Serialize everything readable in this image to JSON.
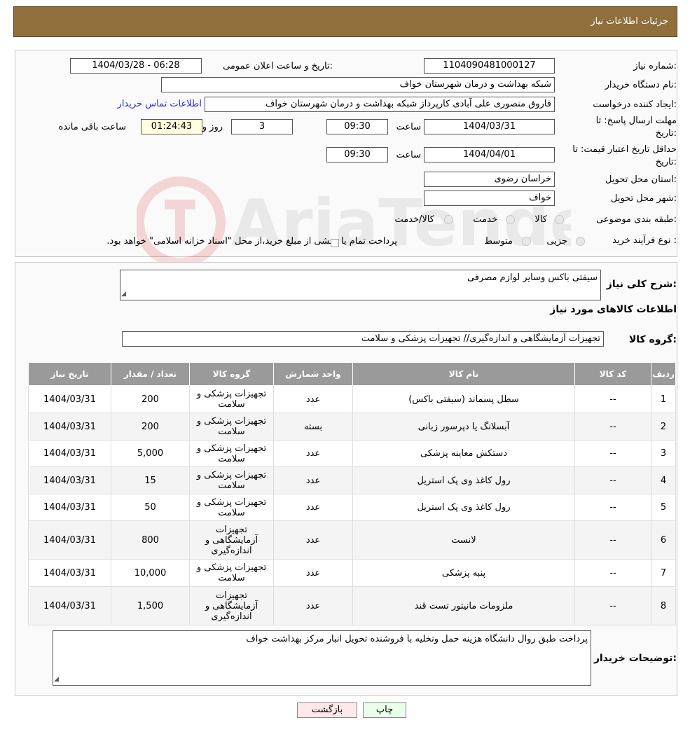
{
  "header": {
    "title": "جزئیات اطلاعات نیاز"
  },
  "watermark": {
    "text": "AriaTender.neT"
  },
  "form": {
    "need_number_label": "شماره نیاز:",
    "need_number": "1104090481000127",
    "announce_label": "تاریخ و ساعت اعلان عمومی:",
    "announce_value": "1404/03/28 - 06:28",
    "buyer_org_label": "نام دستگاه خریدار:",
    "buyer_org": "شبکه بهداشت و درمان شهرستان خواف",
    "requester_label": "ایجاد کننده درخواست:",
    "requester": "فاروق منصوری علی آبادی کارپرداز شبکه بهداشت و درمان شهرستان خواف",
    "contact_link": "اطلاعات تماس خریدار",
    "deadline_label_1": "مهلت ارسال پاسخ: تا",
    "deadline_label_2": "تاریخ:",
    "deadline_date": "1404/03/31",
    "time_label": "ساعت",
    "deadline_time": "09:30",
    "days": "3",
    "days_label": "روز و",
    "remaining": "01:24:43",
    "remaining_label": "ساعت باقی مانده",
    "validity_label_1": "حداقل تاریخ اعتبار قیمت: تا",
    "validity_label_2": "تاریخ:",
    "validity_date": "1404/04/01",
    "validity_time": "09:30",
    "province_label": "استان محل تحویل:",
    "province": "خراسان رضوی",
    "city_label": "شهر محل تحویل:",
    "city": "خواف",
    "category_label": "طبقه بندی موضوعی:",
    "cat_options": [
      "کالا",
      "خدمت",
      "کالا/خدمت"
    ],
    "process_label": "نوع فرآیند خرید :",
    "process_options": [
      "جزیی",
      "متوسط"
    ],
    "process_note": "پرداخت تمام یا بخشی از مبلغ خرید،از محل \"اسناد خزانه اسلامی\" خواهد بود."
  },
  "details": {
    "desc_label": "شرح کلی نیاز:",
    "desc": "سیفتی باکس وسایر لوازم مصرفی",
    "goods_title": "اطلاعات کالاهای مورد نیاز",
    "group_label": "گروه کالا:",
    "group": "تجهیزات آزمایشگاهی و اندازه‌گیری// تجهیزات پزشکی و سلامت",
    "columns": [
      "ردیف",
      "کد کالا",
      "نام کالا",
      "واحد شمارش",
      "گروه کالا",
      "تعداد / مقدار",
      "تاریخ نیاز"
    ],
    "rows": [
      {
        "n": "1",
        "code": "--",
        "name": "سطل پسماند (سیفتی باکس)",
        "unit": "عدد",
        "group": "تجهیزات پزشکی و سلامت",
        "qty": "200",
        "date": "1404/03/31"
      },
      {
        "n": "2",
        "code": "--",
        "name": "آبسلانگ یا دپرسور زبانی",
        "unit": "بسته",
        "group": "تجهیزات پزشکی و سلامت",
        "qty": "200",
        "date": "1404/03/31"
      },
      {
        "n": "3",
        "code": "--",
        "name": "دستکش معاینه پزشکی",
        "unit": "عدد",
        "group": "تجهیزات پزشکی و سلامت",
        "qty": "5,000",
        "date": "1404/03/31"
      },
      {
        "n": "4",
        "code": "--",
        "name": "رول کاغذ وی پک استریل",
        "unit": "عدد",
        "group": "تجهیزات پزشکی و سلامت",
        "qty": "15",
        "date": "1404/03/31"
      },
      {
        "n": "5",
        "code": "--",
        "name": "رول کاغذ وی پک استریل",
        "unit": "عدد",
        "group": "تجهیزات پزشکی و سلامت",
        "qty": "50",
        "date": "1404/03/31"
      },
      {
        "n": "6",
        "code": "--",
        "name": "لانست",
        "unit": "عدد",
        "group": "تجهیزات آزمایشگاهی و اندازه‌گیری",
        "qty": "800",
        "date": "1404/03/31"
      },
      {
        "n": "7",
        "code": "--",
        "name": "پنبه پزشکی",
        "unit": "عدد",
        "group": "تجهیزات پزشکی و سلامت",
        "qty": "10,000",
        "date": "1404/03/31"
      },
      {
        "n": "8",
        "code": "--",
        "name": "ملزومات مانیتور تست قند",
        "unit": "عدد",
        "group": "تجهیزات آزمایشگاهی و اندازه‌گیری",
        "qty": "1,500",
        "date": "1404/03/31"
      }
    ],
    "buyer_notes_label": "توضیحات خریدار:",
    "buyer_notes": "پرداخت طبق روال دانشگاه هزینه حمل وتخلیه با فروشنده تحویل انبار مرکز بهداشت خواف"
  },
  "buttons": {
    "print": "چاپ",
    "back": "بازگشت"
  },
  "colors": {
    "header": "#906f3d",
    "table_header": "#9a9a9a",
    "link": "#2b2bd8",
    "remaining_bg": "#ffffe0",
    "print_bg": "#eaffea",
    "back_bg": "#ffe8e8"
  }
}
